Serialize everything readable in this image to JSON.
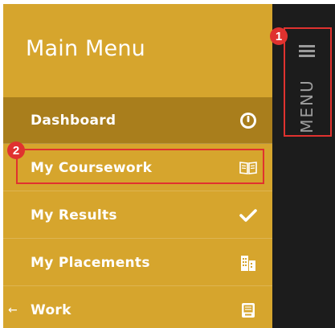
{
  "sidebar": {
    "title": "Main Menu",
    "items": [
      {
        "label": "Dashboard",
        "icon": "dashboard-gauge-icon",
        "active": true
      },
      {
        "label": "My Coursework",
        "icon": "open-book-icon",
        "active": false
      },
      {
        "label": "My Results",
        "icon": "checkmark-icon",
        "active": false
      },
      {
        "label": "My Placements",
        "icon": "buildings-icon",
        "active": false
      },
      {
        "label": "Work",
        "icon": "tray-icon",
        "active": false,
        "back_arrow": "←"
      }
    ]
  },
  "rail": {
    "label": "MENU",
    "icon": "hamburger-icon"
  },
  "annotations": [
    {
      "number": "1",
      "target": "menu-toggle"
    },
    {
      "number": "2",
      "target": "My Coursework"
    }
  ],
  "colors": {
    "panel": "#d6a52d",
    "active_row": "#a97e1c",
    "rail": "#1c1c1c",
    "annotation": "#e0322f"
  }
}
